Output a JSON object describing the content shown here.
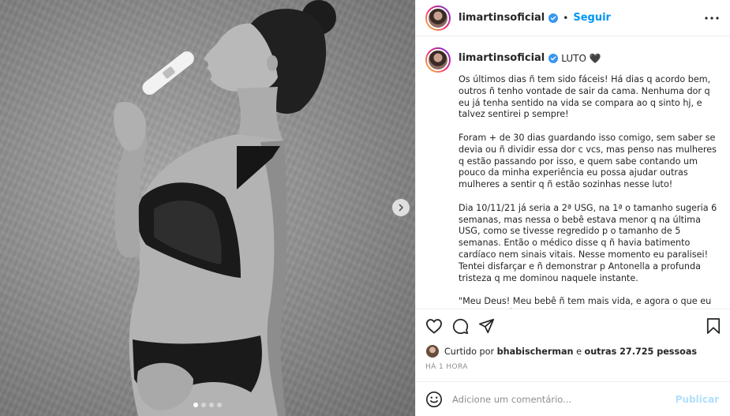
{
  "post": {
    "username": "limartinsoficial",
    "follow_label": "Seguir",
    "separator": "•",
    "caption_title": "LUTO 🖤",
    "caption_text": "Os últimos dias ñ tem sido fáceis! Há dias q acordo bem, outros ñ tenho vontade de sair da cama. Nenhuma dor q eu já tenha sentido na vida se compara ao q sinto hj, e talvez sentirei p sempre!\n\nForam + de 30 dias guardando isso comigo, sem saber se devia ou ñ dividir essa dor c vcs, mas penso nas mulheres q estão passando por isso, e quem sabe contando um pouco da minha experiência eu possa ajudar outras mulheres a sentir q ñ estão sozinhas nesse luto!\n\nDia 10/11/21 já seria a 2ª USG, na 1ª o tamanho sugeria 6 semanas, mas nessa o bebê estava menor q na última USG, como se tivesse regredido p o tamanho de 5 semanas. Então o médico disse q ñ havia batimento cardíaco nem sinais vitais. Nesse momento eu paralisei! Tentei disfarçar e ñ demonstrar p Antonella a profunda tristeza q me dominou naquele instante.\n\n\"Meu Deus! Meu bebê ñ tem mais vida, e agora o que eu faço?\" O médico me\nexplicou q eu poderia esperar o corpo expelir ou fazer a curetagem! Eu optei por esperar, mas ñ imaginava como seria lidar c a ideia de saber q o meu bebê ainda está aqui, mas sem vida!",
    "likes": {
      "prefix": "Curtido por",
      "user": "bhabischerman",
      "connector": "e",
      "others": "outras 27.725 pessoas"
    },
    "time": "HÁ 1 HORA",
    "comment_placeholder": "Adicione um comentário...",
    "publish_label": "Publicar",
    "carousel": {
      "count": 4,
      "active_index": 0
    }
  },
  "icons": {
    "verified": "verified-badge-icon",
    "more": "more-options-icon",
    "like": "heart-icon",
    "comment": "comment-icon",
    "share": "share-icon",
    "save": "bookmark-icon",
    "emoji": "emoji-icon",
    "next": "chevron-right-icon"
  },
  "colors": {
    "accent": "#0095f6",
    "publish_disabled": "#b2dffc",
    "text": "#262626",
    "muted": "#8e8e8e",
    "border": "#efefef"
  }
}
